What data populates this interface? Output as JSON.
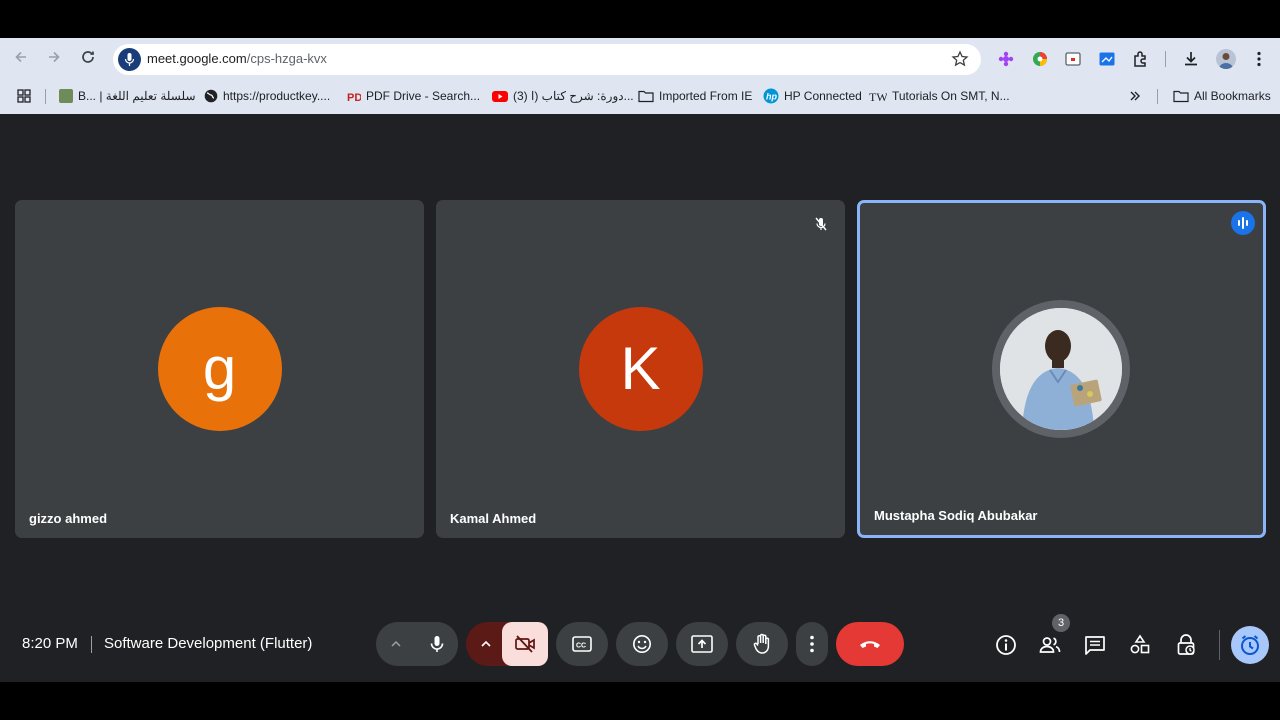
{
  "browser": {
    "url_host": "meet.google.com",
    "url_path": "/cps-hzga-kvx",
    "bookmarks": [
      {
        "label": "B... | سلسلة تعليم اللغة"
      },
      {
        "label": "https://productkey...."
      },
      {
        "label": "PDF Drive - Search..."
      },
      {
        "label": "(3) دورة: شرح كتاب (ا..."
      },
      {
        "label": "Imported From IE"
      },
      {
        "label": "HP Connected"
      },
      {
        "label": "Tutorials On SMT, N..."
      },
      {
        "label": "All Bookmarks"
      }
    ]
  },
  "meeting": {
    "time": "8:20 PM",
    "title": "Software Development (Flutter)",
    "participant_count": "3",
    "participants": [
      {
        "name": "gizzo ahmed",
        "initial": "g",
        "color": "#e8710a"
      },
      {
        "name": "Kamal Ahmed",
        "initial": "K",
        "color": "#c5390c"
      },
      {
        "name": "Mustapha Sodiq Abubakar",
        "initial": "",
        "color": "#a8c7fa"
      }
    ]
  },
  "colors": {
    "meet_bg": "#202124",
    "tile_bg": "#3c4043",
    "active_border": "#8ab4f8",
    "end_call": "#e53935",
    "camera_off": "#5c1a16"
  }
}
